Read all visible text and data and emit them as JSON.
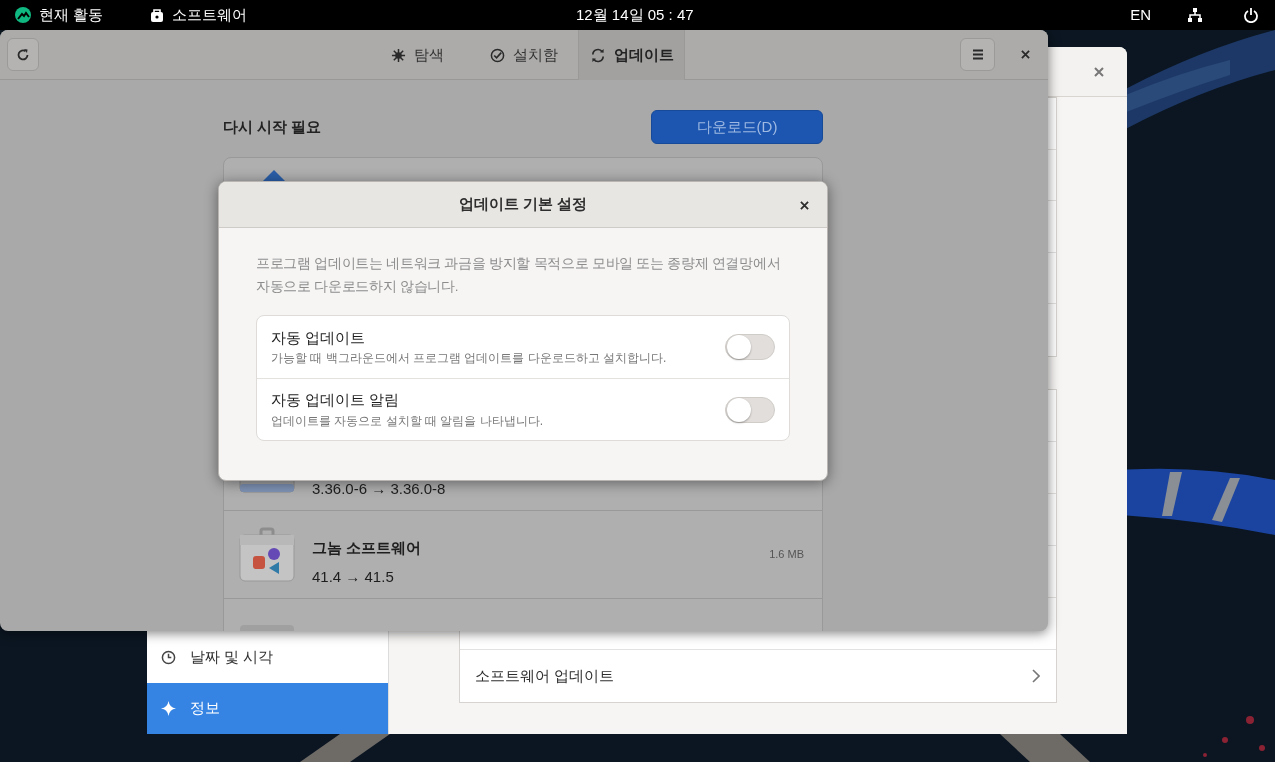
{
  "top_bar": {
    "activities": "현재 활동",
    "app_menu": "소프트웨어",
    "clock": "12월 14일 05 : 47",
    "input_source": "EN"
  },
  "settings_window": {
    "sidebar": {
      "items": [
        {
          "label": "날짜 및 시각",
          "selected": false
        },
        {
          "label": "정보",
          "selected": true
        }
      ]
    },
    "rows": [
      {
        "label": "소프트웨어 업데이트"
      }
    ]
  },
  "software_window": {
    "tabs": [
      {
        "label": "탐색",
        "selected": false
      },
      {
        "label": "설치함",
        "selected": false
      },
      {
        "label": "업데이트",
        "selected": true
      }
    ],
    "section_title": "다시 시작 필요",
    "download_button": "다운로드(D)",
    "updates": [
      {
        "version": "3.36.0-6 → 3.36.0-8"
      },
      {
        "name": "그놈 소프트웨어",
        "version": "41.4 → 41.5",
        "size": "1.6 MB"
      }
    ]
  },
  "dialog": {
    "title": "업데이트 기본 설정",
    "description": "프로그램 업데이트는 네트워크 과금을 방지할 목적으로 모바일 또는 종량제 연결망에서 자동으로 다운로드하지 않습니다.",
    "options": [
      {
        "title": "자동 업데이트",
        "subtitle": "가능할 때 백그라운드에서 프로그램 업데이트를 다운로드하고 설치합니다.",
        "on": false
      },
      {
        "title": "자동 업데이트 알림",
        "subtitle": "업데이트를 자동으로 설치할 때 알림을 나타냅니다.",
        "on": false
      }
    ]
  }
}
